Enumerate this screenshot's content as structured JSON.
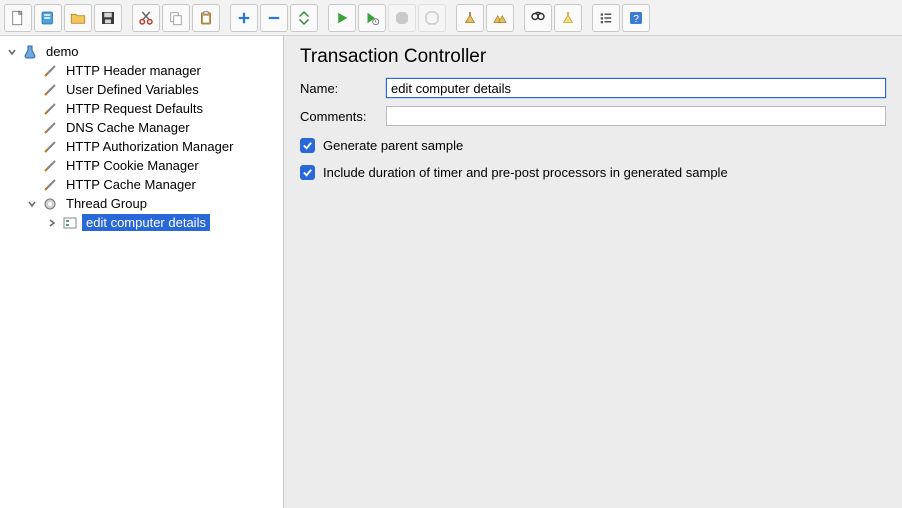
{
  "toolbar": {
    "buttons": [
      {
        "name": "new-file",
        "title": "New"
      },
      {
        "name": "templates",
        "title": "Templates"
      },
      {
        "name": "open-file",
        "title": "Open"
      },
      {
        "name": "save-file",
        "title": "Save"
      },
      {
        "sep": true
      },
      {
        "name": "cut",
        "title": "Cut"
      },
      {
        "name": "copy",
        "title": "Copy"
      },
      {
        "name": "paste",
        "title": "Paste"
      },
      {
        "sep": true
      },
      {
        "name": "add",
        "title": "Add"
      },
      {
        "name": "remove",
        "title": "Remove"
      },
      {
        "name": "expand",
        "title": "Expand/Collapse"
      },
      {
        "sep": true
      },
      {
        "name": "start",
        "title": "Start"
      },
      {
        "name": "start-no-pause",
        "title": "Start no pauses"
      },
      {
        "name": "stop",
        "title": "Stop"
      },
      {
        "name": "shutdown",
        "title": "Shutdown"
      },
      {
        "sep": true
      },
      {
        "name": "clear",
        "title": "Clear"
      },
      {
        "name": "clear-all",
        "title": "Clear All"
      },
      {
        "sep": true
      },
      {
        "name": "search",
        "title": "Search"
      },
      {
        "name": "reset-search",
        "title": "Reset Search"
      },
      {
        "sep": true
      },
      {
        "name": "function-helper",
        "title": "Function Helper"
      },
      {
        "name": "help",
        "title": "Help"
      }
    ]
  },
  "tree": {
    "root": {
      "label": "demo",
      "children": [
        {
          "label": "HTTP Header manager",
          "icon": "config"
        },
        {
          "label": "User Defined Variables",
          "icon": "config"
        },
        {
          "label": "HTTP Request Defaults",
          "icon": "config"
        },
        {
          "label": "DNS Cache Manager",
          "icon": "config"
        },
        {
          "label": "HTTP Authorization Manager",
          "icon": "config"
        },
        {
          "label": "HTTP Cookie Manager",
          "icon": "config"
        },
        {
          "label": "HTTP Cache Manager",
          "icon": "config"
        },
        {
          "label": "Thread Group",
          "icon": "thread",
          "expanded": true,
          "children": [
            {
              "label": "edit computer details",
              "icon": "controller",
              "selected": true,
              "hasChildren": true
            }
          ]
        }
      ]
    }
  },
  "detail": {
    "heading": "Transaction Controller",
    "name_label": "Name:",
    "name_value": "edit computer details",
    "comments_label": "Comments:",
    "comments_value": "",
    "check_generate_parent": "Generate parent sample",
    "check_include_duration": "Include duration of timer and pre-post processors in generated sample"
  }
}
